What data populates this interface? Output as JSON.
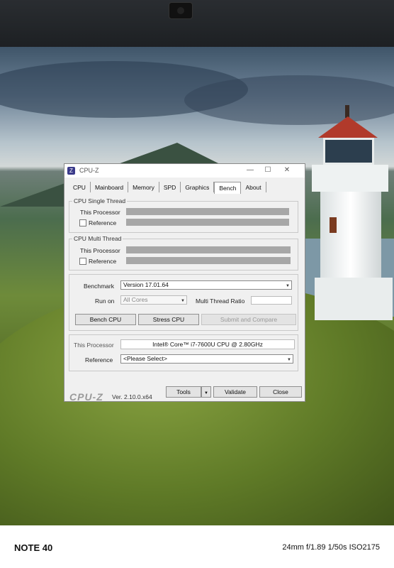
{
  "window": {
    "title": "CPU-Z",
    "icon": "cpu-z-app-icon",
    "controls": {
      "minimize": "—",
      "maximize": "☐",
      "close": "✕"
    }
  },
  "tabs": [
    "CPU",
    "Mainboard",
    "Memory",
    "SPD",
    "Graphics",
    "Bench",
    "About"
  ],
  "active_tab": "Bench",
  "single_thread": {
    "label": "CPU Single Thread",
    "this_processor": "This Processor",
    "reference": "Reference"
  },
  "multi_thread": {
    "label": "CPU Multi Thread",
    "this_processor": "This Processor",
    "reference": "Reference"
  },
  "settings": {
    "benchmark_label": "Benchmark",
    "benchmark_value": "Version 17.01.64",
    "run_on_label": "Run on",
    "run_on_value": "All Cores",
    "multi_thread_ratio_label": "Multi Thread Ratio",
    "bench_cpu": "Bench CPU",
    "stress_cpu": "Stress CPU",
    "submit_compare": "Submit and Compare"
  },
  "processor": {
    "this_processor_label": "This Processor",
    "this_processor_value": "Intel® Core™ i7-7600U CPU @ 2.80GHz",
    "reference_label": "Reference",
    "reference_value": "<Please Select>"
  },
  "footer": {
    "logo": "CPU-Z",
    "version": "Ver. 2.10.0.x64",
    "tools": "Tools",
    "validate": "Validate",
    "close": "Close"
  },
  "photo_watermark": {
    "device": "NOTE 40",
    "exif": "24mm f/1.89 1/50s ISO2175"
  }
}
